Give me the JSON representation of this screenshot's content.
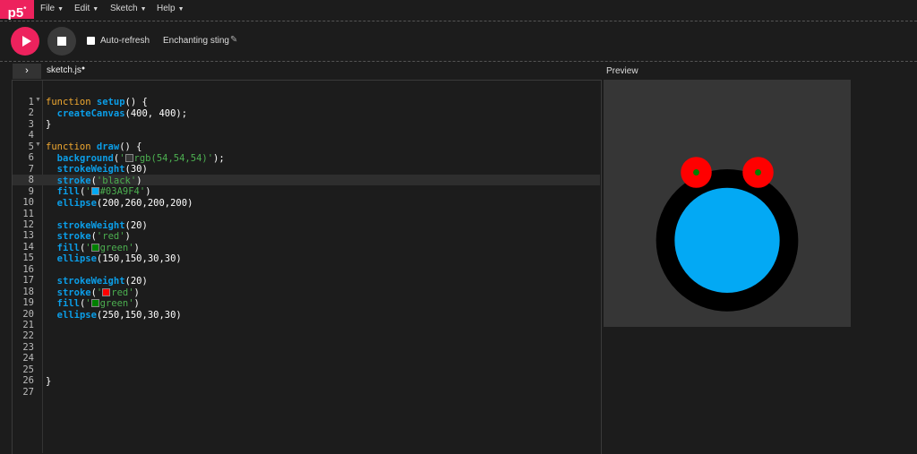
{
  "app": {
    "logo": "p5",
    "logo_sup": "*"
  },
  "menu": [
    {
      "label": "File"
    },
    {
      "label": "Edit"
    },
    {
      "label": "Sketch"
    },
    {
      "label": "Help"
    }
  ],
  "toolbar": {
    "auto_refresh_label": "Auto-refresh",
    "auto_refresh_checked": false,
    "sketch_name": "Enchanting sting"
  },
  "editor": {
    "file_tab": "sketch.js",
    "file_modified_marker": "●",
    "toggle_icon": "chevron-right-icon",
    "line_numbers": [
      "1",
      "2",
      "3",
      "4",
      "5",
      "6",
      "7",
      "8",
      "9",
      "10",
      "11",
      "12",
      "13",
      "14",
      "15",
      "16",
      "17",
      "18",
      "19",
      "20",
      "21",
      "22",
      "23",
      "24",
      "25",
      "26",
      "27"
    ],
    "active_line": 8
  },
  "preview": {
    "label": "Preview",
    "background": "rgb(54,54,54)"
  },
  "colors": {
    "brand": "#ed225d",
    "fill_blue": "#03A9F4",
    "keyword": "#f0a830",
    "function": "#0b9ee8",
    "string": "#4caf50"
  }
}
